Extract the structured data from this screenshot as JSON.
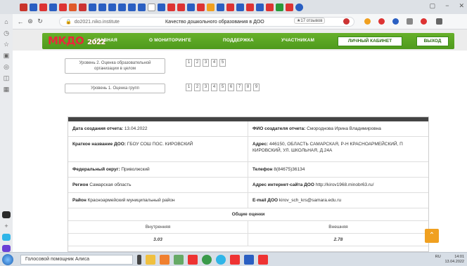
{
  "browser": {
    "url": "do2021.niko.institute",
    "page_title": "Качество дошкольного образования в ДОО",
    "reviews_badge": "★17 отзывов",
    "back_icon": "arrow-left-icon",
    "reload_icon": "reload-icon",
    "window_controls": [
      "▢",
      "−",
      "✕"
    ]
  },
  "site": {
    "logo": "МКДО",
    "logo_year": "2022",
    "nav": {
      "main": "ГЛАВНАЯ",
      "monitoring": "О МОНИТОРИНГЕ",
      "support": "ПОДДЕРЖКА",
      "participants": "УЧАСТНИКАМ",
      "cabinet": "ЛИЧНЫЙ КАБИНЕТ",
      "exit": "ВЫХОД"
    },
    "level2": {
      "label": "Уровень 2. Оценка образовательной организации в целом",
      "pages": [
        "1",
        "2",
        "3",
        "4",
        "5"
      ]
    },
    "level1": {
      "label": "Уровень 1. Оценка групп",
      "pages": [
        "1",
        "2",
        "3",
        "4",
        "5",
        "6",
        "7",
        "8",
        "9"
      ]
    },
    "report": {
      "date_label": "Дата создания отчета:",
      "date_value": "13.04.2022",
      "author_label": "ФИО создателя отчета:",
      "author_value": "Смороднова Ирина Владимировна",
      "short_name_label": "Краткое название ДОО:",
      "short_name_value": "ГБОУ СОШ ПОС. КИРОВСКИЙ",
      "address_label": "Адрес:",
      "address_value": "446150, ОБЛАСТЬ САМАРСКАЯ, Р-Н КРАСНОАРМЕЙСКИЙ, П КИРОВСКИЙ, УЛ. ШКОЛЬНАЯ, Д.24А",
      "district_label": "Федеральный округ:",
      "district_value": "Приволжский",
      "phone_label": "Телефон",
      "phone_value": "8(84675)36134",
      "region_label": "Регион",
      "region_value": "Самарская область",
      "website_label": "Адрес интернет-сайта ДОО",
      "website_value": "http://kirov1968.minobr63.ru/",
      "area_label": "Район",
      "area_value": "Красноармейский муниципальный район",
      "email_label": "E-mail ДОО",
      "email_value": "kirov_sch_krs@samara.edu.ru",
      "summary_title": "Общие оценки",
      "internal_label": "Внутренняя",
      "external_label": "Внешняя",
      "internal_value": "3.03",
      "external_value": "2.78"
    }
  },
  "taskbar": {
    "assistant": "Голосовой помощник Алиса",
    "tray_lang": "RU",
    "time": "14:01",
    "date": "13.04.2022"
  },
  "colors": {
    "nav_green": "#5aa624",
    "logo_red": "#e8283a",
    "to_top_orange": "#f0a020"
  }
}
